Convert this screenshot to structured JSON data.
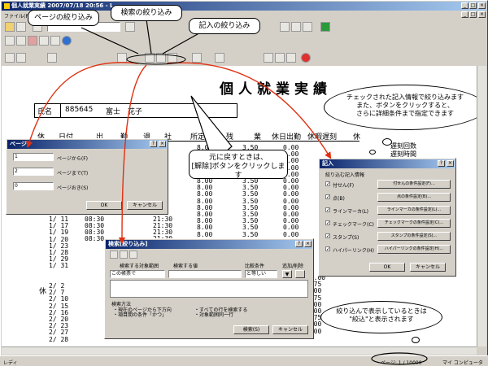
{
  "window": {
    "title": "個人就業実績 2007/07/18 20:56 - L"
  },
  "menu": [
    "ファイル(F)"
  ],
  "report": {
    "title": "個人就業実績",
    "name_label": "氏名",
    "emp_id": "885645",
    "emp_name": "富士　花子",
    "headers": [
      "休",
      "日付",
      "出",
      "勤",
      "退",
      "社",
      "所定",
      "残",
      "業",
      "休日出勤",
      "休暇遅刻",
      "休"
    ],
    "side_text": [
      "遅刻回数",
      "遅刻時間"
    ],
    "kyu_label": "休",
    "dates_a": [
      "1/ 11",
      "1/ 17",
      "1/ 19",
      "1/ 20",
      "1/ 23",
      "1/ 28",
      "1/ 29",
      "1/ 31"
    ],
    "dates_b": [
      "2/  2",
      "2/  7",
      "2/ 10",
      "2/ 15",
      "2/ 16",
      "2/ 20",
      "2/ 23",
      "2/ 27",
      "2/ 28"
    ],
    "times_in": [
      "08:30",
      "08:30",
      "08:30",
      "08:30"
    ],
    "times_out": [
      "21:30",
      "21:30",
      "21:30",
      "21:30"
    ],
    "shotei": [
      "8.00",
      "8.00",
      "8.00",
      "8.00",
      "8.00",
      "8.00",
      "8.00",
      "8.00",
      "8.00",
      "8.00",
      "8.00",
      "8.00",
      "8.00",
      "8.00",
      "8.00"
    ],
    "zan": [
      "3.50",
      "3.50",
      "3.50",
      "3.50",
      "3.50",
      "3.50",
      "3.50",
      "3.50",
      "3.50",
      "3.50",
      "3.50",
      "3.50",
      "3.50",
      "3.50"
    ],
    "zero": [
      "0.00",
      "0.00",
      "0.00",
      "0.00",
      "0.00",
      "0.00",
      "0.00",
      "0.00",
      "0.00",
      "0.00",
      "0.00",
      "0.00",
      "0.00",
      "0.00"
    ],
    "right_col": [
      "12.00",
      "0.75",
      "1.00",
      "0.75",
      "2.00",
      "1.00",
      "0.75",
      "1.00",
      "1.00"
    ]
  },
  "page_dialog": {
    "title": "ページ",
    "from_val": "1",
    "from_label": "ページから(F)",
    "to_val": "2",
    "to_label": "ページまで(T)",
    "step_val": "0",
    "step_label": "ページおき(S)",
    "ok": "OK",
    "cancel": "キャンセル"
  },
  "search_dialog": {
    "title": "検索[絞り込み]",
    "col1": "検索する対象範囲",
    "col2": "検索する値",
    "col3": "比較条件",
    "col4": "追加/削除",
    "range_value": "この帳票で",
    "cond_value": "と等しい",
    "method_label": "検索方法",
    "opt1": "・現在のページから下方向",
    "opt2": "・すべての行を検索する",
    "opt3": "・項目間の条件「かつ」",
    "opt4": "・対象範囲同一行",
    "search_btn": "検索(S)",
    "cancel": "キャンセル"
  },
  "note_dialog": {
    "title": "記入",
    "group": "絞り込む記入情報",
    "items": [
      {
        "label": "付せん(F)",
        "btn": "付せんの条件設定(F)..."
      },
      {
        "label": "点(B)",
        "btn": "点の条件設定(B)..."
      },
      {
        "label": "ラインマーカ(L)",
        "btn": "ラインマーカの条件設定(L)..."
      },
      {
        "label": "チェックマーク(C)",
        "btn": "チェックマークの条件設定(C)..."
      },
      {
        "label": "スタンプ(S)",
        "btn": "スタンプの条件設定(S)..."
      },
      {
        "label": "ハイパーリンク(H)",
        "btn": "ハイパーリンクの条件設定(H)..."
      }
    ],
    "ok": "OK",
    "cancel": "キャンセル"
  },
  "callouts": {
    "page": "ページの絞り込み",
    "search": "検索の絞り込み",
    "note": "記入の絞り込み",
    "restore": "元に戻すときは、\n[解除]ボタンをクリックします",
    "check": "チェックされた記入情報で絞り込みます\nまた、ボタンをクリックすると、\nさらに詳細条件まで指定できます",
    "filtered": "絞り込んで表示しているときは\n\"絞込\"と表示されます"
  },
  "status": {
    "ready": "レディ",
    "page": "ページ: 1 / 10000",
    "computer": "マイ コンピュータ"
  },
  "colors": {
    "title_blue": "#0a246a",
    "arrow": "#e03010",
    "face": "#d4d0c8"
  }
}
